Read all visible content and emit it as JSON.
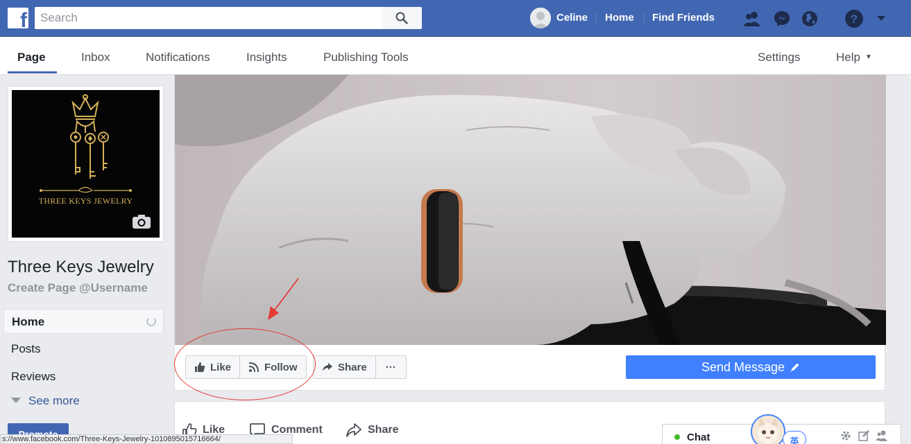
{
  "topbar": {
    "logo_letter": "f",
    "search_placeholder": "Search",
    "user_name": "Celine",
    "home": "Home",
    "find_friends": "Find Friends",
    "icons": [
      "friend-requests-icon",
      "messenger-icon",
      "notifications-globe-icon",
      "help-icon",
      "account-menu-icon"
    ]
  },
  "page_nav": {
    "tabs": [
      {
        "label": "Page",
        "active": true
      },
      {
        "label": "Inbox"
      },
      {
        "label": "Notifications"
      },
      {
        "label": "Insights"
      },
      {
        "label": "Publishing Tools"
      }
    ],
    "settings": "Settings",
    "help": "Help"
  },
  "profile": {
    "logo_text": "THREE KEYS JEWELRY",
    "name": "Three Keys Jewelry",
    "username_link": "Create Page @Username"
  },
  "left_nav": {
    "items": [
      {
        "label": "Home",
        "active": true
      },
      {
        "label": "Posts"
      },
      {
        "label": "Reviews"
      }
    ],
    "see_more": "See more",
    "promote": "Promote"
  },
  "actions": {
    "like": "Like",
    "follow": "Follow",
    "share": "Share",
    "more": "···",
    "send_message": "Send Message"
  },
  "post_bar": {
    "like": "Like",
    "comment": "Comment",
    "share": "Share"
  },
  "chat": {
    "label": "Chat",
    "ime_char": "英"
  },
  "status_bar": {
    "url": "s://www.facebook.com/Three-Keys-Jewelry-1010895015716664/"
  },
  "colors": {
    "brand_blue": "#4267b2",
    "send_button": "#4080ff",
    "annotation_red": "#e53935",
    "online_green": "#42b72a"
  }
}
